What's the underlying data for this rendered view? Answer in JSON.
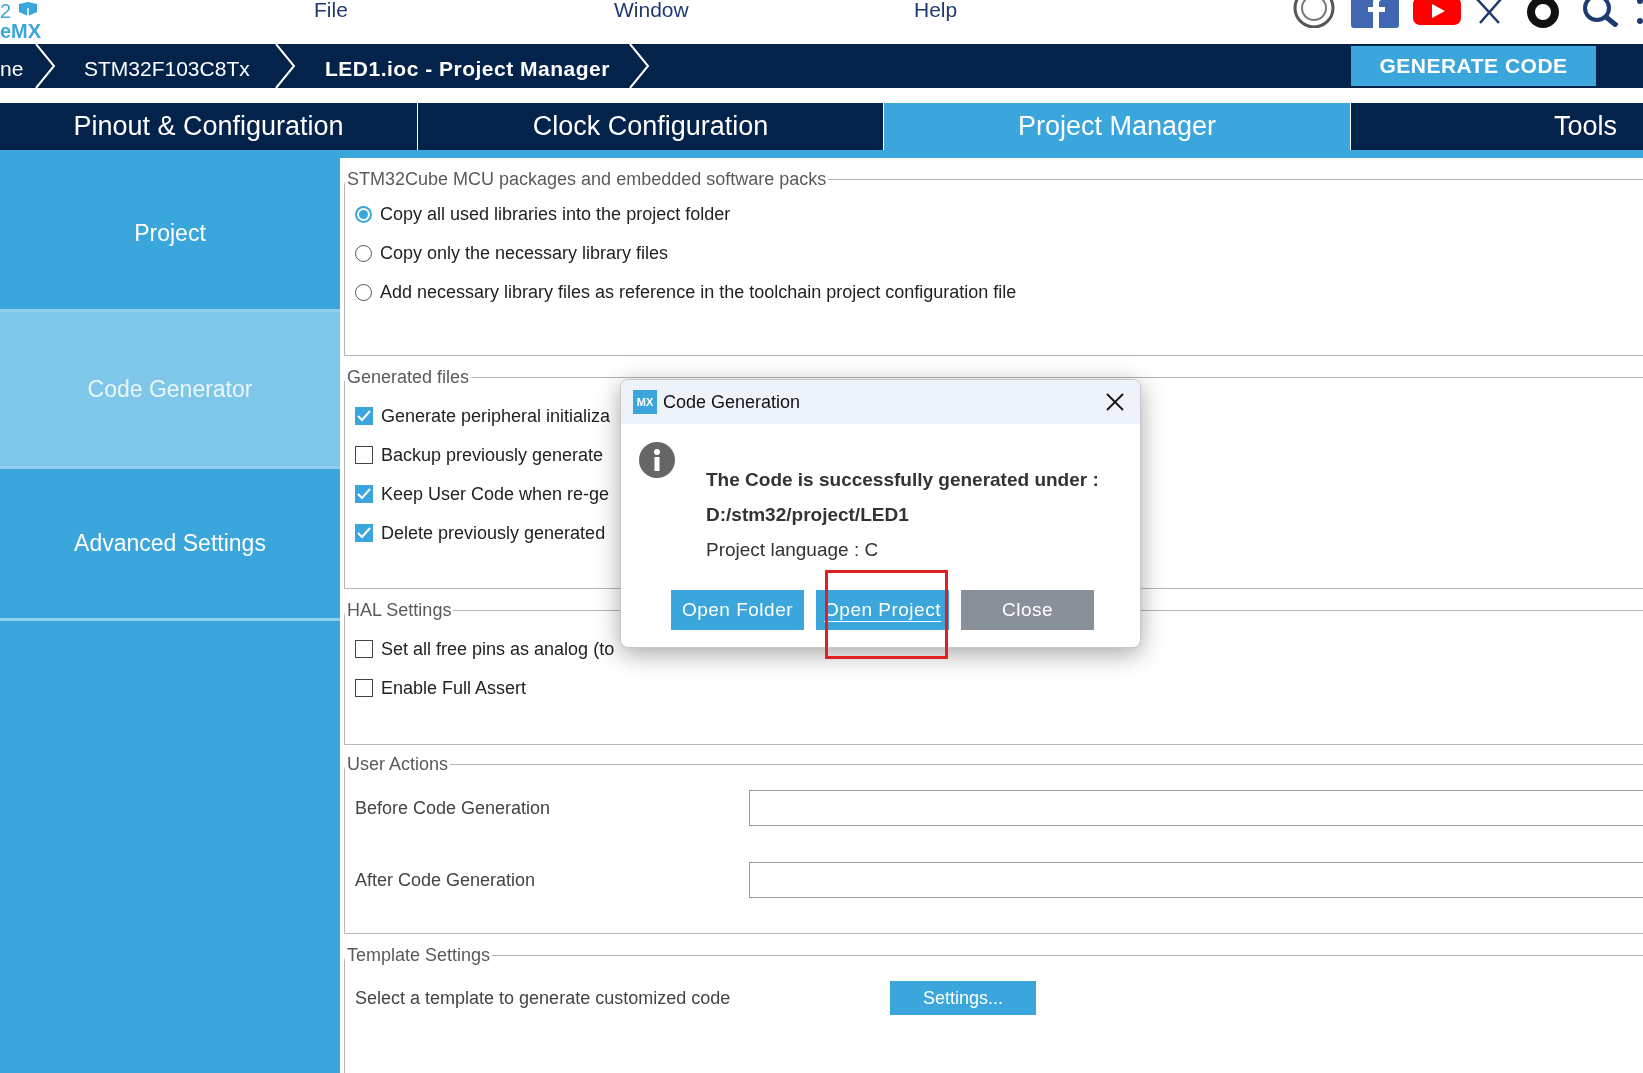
{
  "logo": {
    "lines": [
      "2",
      "eMX"
    ]
  },
  "menu": [
    "File",
    "Window",
    "Help"
  ],
  "breadcrumb": [
    {
      "label": "ne",
      "current": false
    },
    {
      "label": "STM32F103C8Tx",
      "current": false
    },
    {
      "label": "LED1.ioc - Project Manager",
      "current": true
    }
  ],
  "generate_button": "GENERATE CODE",
  "tabs": [
    {
      "label": "Pinout & Configuration",
      "selected": false
    },
    {
      "label": "Clock Configuration",
      "selected": false
    },
    {
      "label": "Project Manager",
      "selected": true
    },
    {
      "label": "Tools",
      "selected": false
    }
  ],
  "sidebar": {
    "items": [
      {
        "label": "Project",
        "selected": false
      },
      {
        "label": "Code Generator",
        "selected": true
      },
      {
        "label": "Advanced Settings",
        "selected": false
      }
    ]
  },
  "sections": [
    {
      "title": "STM32Cube MCU packages and embedded software packs",
      "options": [
        {
          "kind": "radio",
          "label": "Copy all used libraries into the project folder",
          "checked": true
        },
        {
          "kind": "radio",
          "label": "Copy only the necessary library files",
          "checked": false
        },
        {
          "kind": "radio",
          "label": "Add necessary library files as reference in the toolchain project configuration file",
          "checked": false
        }
      ]
    },
    {
      "title": "Generated files",
      "options": [
        {
          "kind": "checkbox",
          "label": "Generate peripheral initializa",
          "checked": true
        },
        {
          "kind": "checkbox",
          "label": "Backup previously generate",
          "checked": false
        },
        {
          "kind": "checkbox",
          "label": "Keep User Code when re-ge",
          "checked": true
        },
        {
          "kind": "checkbox",
          "label": "Delete previously generated",
          "checked": true
        }
      ]
    },
    {
      "title": "HAL Settings",
      "options": [
        {
          "kind": "checkbox",
          "label": "Set all free pins as analog (to",
          "checked": false
        },
        {
          "kind": "checkbox",
          "label": "Enable Full Assert",
          "checked": false
        }
      ]
    }
  ],
  "user_actions": {
    "title": "User Actions",
    "fields": [
      {
        "label": "Before Code Generation"
      },
      {
        "label": "After Code Generation"
      }
    ]
  },
  "template_settings": {
    "title": "Template Settings",
    "text": "Select a template to generate customized code",
    "button": "Settings..."
  },
  "dialog": {
    "title": "Code Generation",
    "app_badge": "MX",
    "message": [
      "The Code is successfully generated under :",
      "D:/stm32/project/LED1"
    ],
    "language": "Project language : C",
    "buttons": [
      {
        "label": "Open Folder",
        "kind": "primary",
        "focused": false
      },
      {
        "label": "Open Project",
        "kind": "primary",
        "focused": true
      },
      {
        "label": "Close",
        "kind": "secondary",
        "focused": false
      }
    ]
  }
}
